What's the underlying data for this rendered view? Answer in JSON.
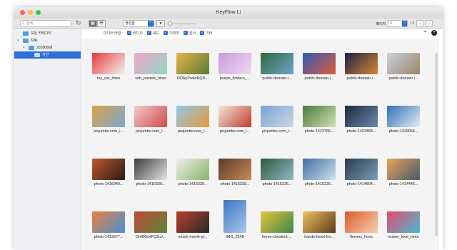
{
  "window": {
    "title": "KeyFlow Li"
  },
  "toolbar": {
    "search_placeholder": "검색",
    "sort_label": "생성일",
    "sort_dir": "▼",
    "page_label": "페이지",
    "page_value": "1",
    "page_total": "/ 1"
  },
  "sidebar": {
    "items": [
      {
        "label": "모든 카테고리",
        "level": 0,
        "selected": false,
        "expanded": false
      },
      {
        "label": "자료",
        "level": 0,
        "selected": false,
        "expanded": true
      },
      {
        "label": "20180608",
        "level": 1,
        "selected": false,
        "expanded": true
      },
      {
        "label": "사진",
        "level": 2,
        "selected": true,
        "expanded": false
      }
    ]
  },
  "filters": {
    "label": "미디어 타입 :",
    "items": [
      "비디오",
      "워드",
      "이미지",
      "문서",
      "기타"
    ]
  },
  "tiles": [
    {
      "label": "toy_car_hires",
      "color": "#e83a3a",
      "color2": "#f3f3f3",
      "tall": false
    },
    {
      "label": "soft_pastels_hires",
      "color": "#f3a6c8",
      "color2": "#8fd6c4",
      "tall": false
    },
    {
      "label": "RDNyPwknRQD...",
      "color": "#e8b24a",
      "color2": "#5a7a3a",
      "tall": false
    },
    {
      "label": "purple_flowers_...",
      "color": "#c79bd9",
      "color2": "#f0d8f0",
      "tall": false
    },
    {
      "label": "public-domain-i...",
      "color": "#2f6b3a",
      "color2": "#6fa3c9",
      "tall": false
    },
    {
      "label": "public-domain-i...",
      "color": "#2b5db8",
      "color2": "#e05a3a",
      "tall": false
    },
    {
      "label": "public-domain-i...",
      "color": "#1b1f4d",
      "color2": "#d6882e",
      "tall": false
    },
    {
      "label": "public-domain-i...",
      "color": "#c9d3dc",
      "color2": "#9c8467",
      "tall": false
    },
    {
      "label": "picjumbo.com_l...",
      "color": "#d9a441",
      "color2": "#7aa7d8",
      "tall": false
    },
    {
      "label": "picjumbo.com_l...",
      "color": "#f0c9c9",
      "color2": "#d24a4a",
      "tall": false
    },
    {
      "label": "picjumbo.com_l...",
      "color": "#8fc7e8",
      "color2": "#e69a3a",
      "tall": false
    },
    {
      "label": "picjumbo.com_l...",
      "color": "#f2e9df",
      "color2": "#c0392b",
      "tall": false
    },
    {
      "label": "picjumbo.com_l...",
      "color": "#7aa3d6",
      "color2": "#c9d7e3",
      "tall": false
    },
    {
      "label": "photo-1423766...",
      "color": "#4f7a3a",
      "color2": "#cfe0b6",
      "tall": false
    },
    {
      "label": "photo-1423483...",
      "color": "#1f2a3a",
      "color2": "#6a87b3",
      "tall": false
    },
    {
      "label": "photo-1419064...",
      "color": "#2d6fb8",
      "color2": "#e5eef6",
      "tall": false
    },
    {
      "label": "photo-1416949...",
      "color": "#c25a2a",
      "color2": "#2a1a1a",
      "tall": false
    },
    {
      "label": "photo-1416339...",
      "color": "#3a3a3a",
      "color2": "#e6e6e6",
      "tall": false
    },
    {
      "label": "photo-1416339...",
      "color": "#eef0ea",
      "color2": "#8ab56a",
      "tall": false
    },
    {
      "label": "photo-1416339...",
      "color": "#5a3a2a",
      "color2": "#c98a5a",
      "tall": false
    },
    {
      "label": "photo-1415226...",
      "color": "#2f5a3a",
      "color2": "#8fb8c9",
      "tall": false
    },
    {
      "label": "photo-1415226...",
      "color": "#3f6f9f",
      "color2": "#cfe0ef",
      "tall": false
    },
    {
      "label": "photo-1414804...",
      "color": "#2a3a4a",
      "color2": "#7a9fb8",
      "tall": false
    },
    {
      "label": "photo-1414445...",
      "color": "#e8a35a",
      "color2": "#4a5a6a",
      "tall": false
    },
    {
      "label": "photo-1413977...",
      "color": "#e8823a",
      "color2": "#4a8fd6",
      "tall": false
    },
    {
      "label": "OhRKhvIFQ2uJ...",
      "color": "#c0463a",
      "color2": "#5a8a3a",
      "tall": false
    },
    {
      "label": "music-movie-pl...",
      "color": "#b8402f",
      "color2": "#2a2a2a",
      "tall": false
    },
    {
      "label": "IMG_2248",
      "color": "#3b74c4",
      "color2": "#aac8e8",
      "tall": true
    },
    {
      "label": "horse-chestnut-...",
      "color": "#e8c23a",
      "color2": "#3a8a4a",
      "tall": false
    },
    {
      "label": "hands-heart-lov...",
      "color": "#f0c260",
      "color2": "#5a3a1a",
      "tall": false
    },
    {
      "label": "flowers_hires",
      "color": "#e05a2a",
      "color2": "#f2d0b0",
      "tall": false
    },
    {
      "label": "eraser_love_hires",
      "color": "#e84a6a",
      "color2": "#4ab8d6",
      "tall": false
    }
  ]
}
